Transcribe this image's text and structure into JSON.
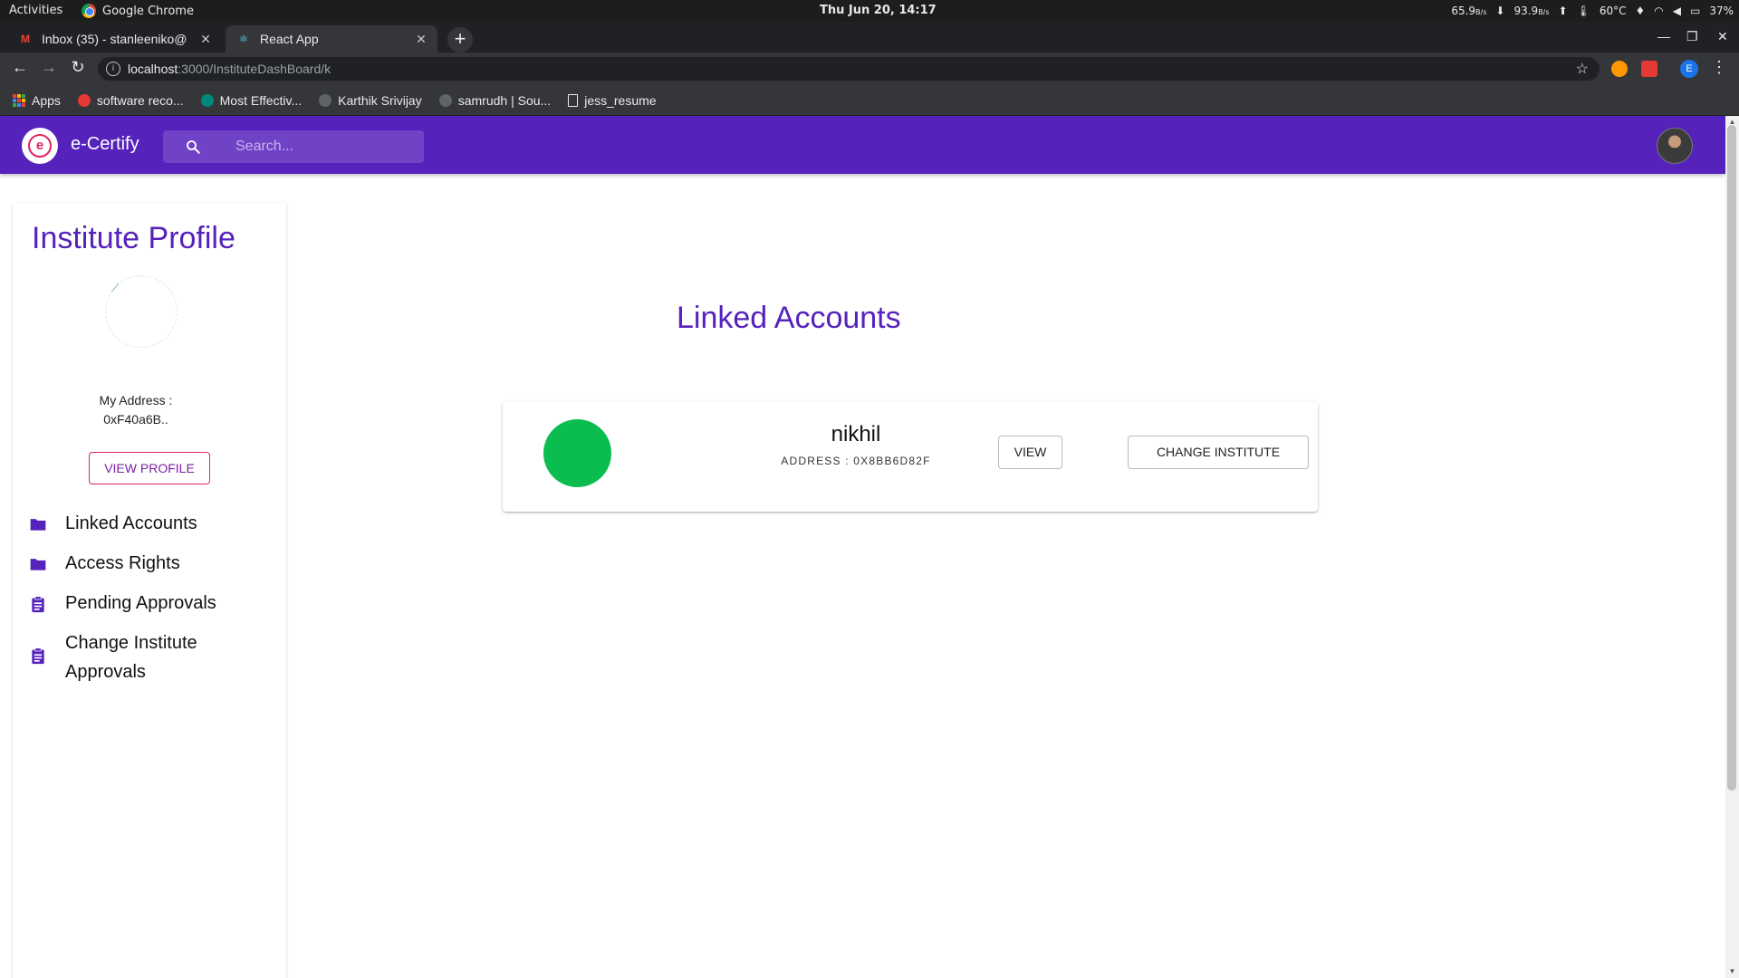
{
  "system": {
    "activities": "Activities",
    "app_name": "Google Chrome",
    "clock": "Thu Jun 20, 14:17",
    "down_speed": "65.9",
    "down_unit": "B/s",
    "up_speed": "93.9",
    "up_unit": "B/s",
    "temp": "60°C",
    "battery": "37%"
  },
  "browser": {
    "tabs": [
      {
        "label": "Inbox (35) - stanleeniko@",
        "favicon": "gmail-icon"
      },
      {
        "label": "React App",
        "favicon": "react-icon"
      }
    ],
    "url_host": "localhost",
    "url_path": ":3000/InstituteDashBoard/k",
    "profile_initial": "E",
    "bookmarks": [
      {
        "label": "Apps",
        "icon": "apps-grid-icon"
      },
      {
        "label": "software reco...",
        "icon": "ask-icon",
        "color": "#e53935"
      },
      {
        "label": "Most Effectiv...",
        "icon": "site-icon",
        "color": "#00897b"
      },
      {
        "label": "Karthik Srivijay",
        "icon": "github-icon",
        "color": "#9e9e9e"
      },
      {
        "label": "samrudh | Sou...",
        "icon": "sourcerer-icon",
        "color": "#9e9e9e"
      },
      {
        "label": "jess_resume",
        "icon": "doc-icon",
        "color": "#e8eaed"
      }
    ]
  },
  "appbar": {
    "brand": "e-Certify",
    "search_placeholder": "Search...",
    "colors": {
      "primary": "#5622bc",
      "accent": "#e0245e"
    }
  },
  "sidebar": {
    "title": "Institute Profile",
    "address_label": "My Address :",
    "address_value": "0xF40a6B..",
    "view_profile": "VIEW PROFILE",
    "menu": [
      {
        "label": "Linked Accounts",
        "icon": "folder-icon"
      },
      {
        "label": "Access Rights",
        "icon": "folder-icon"
      },
      {
        "label": "Pending Approvals",
        "icon": "clipboard-icon"
      },
      {
        "label": "Change Institute Approvals",
        "icon": "clipboard-icon"
      }
    ]
  },
  "main": {
    "title": "Linked Accounts",
    "accounts": [
      {
        "name": "nikhil",
        "address": "ADDRESS : 0X8BB6D82F",
        "status_color": "#0bbd4f",
        "view_label": "VIEW",
        "change_label": "CHANGE INSTITUTE"
      }
    ]
  }
}
